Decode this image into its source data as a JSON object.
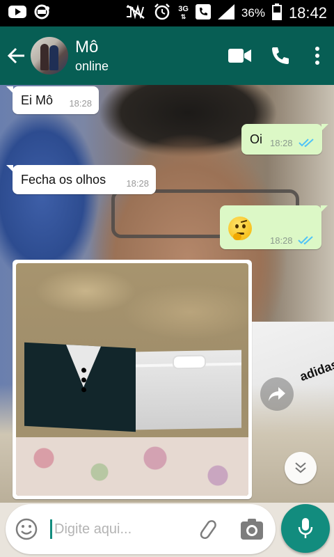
{
  "status_bar": {
    "battery_percent": "36%",
    "time": "18:42",
    "network": "3G"
  },
  "header": {
    "contact_name": "Mô",
    "contact_status": "online"
  },
  "messages": [
    {
      "direction": "incoming",
      "text": "Ei Mô",
      "time": "18:28"
    },
    {
      "direction": "outgoing",
      "text": "Oi",
      "time": "18:28",
      "ticks": "read"
    },
    {
      "direction": "incoming",
      "text": "Fecha os olhos",
      "time": "18:28"
    },
    {
      "direction": "outgoing",
      "text": "",
      "emoji": "thinking-face",
      "time": "18:28",
      "ticks": "read"
    },
    {
      "direction": "incoming",
      "type": "image"
    }
  ],
  "composer": {
    "placeholder": "Digite aqui..."
  },
  "colors": {
    "header": "#075e54",
    "accent": "#128c7e",
    "outgoing_bubble": "#dcf8c6",
    "read_ticks": "#4fc3f7"
  }
}
